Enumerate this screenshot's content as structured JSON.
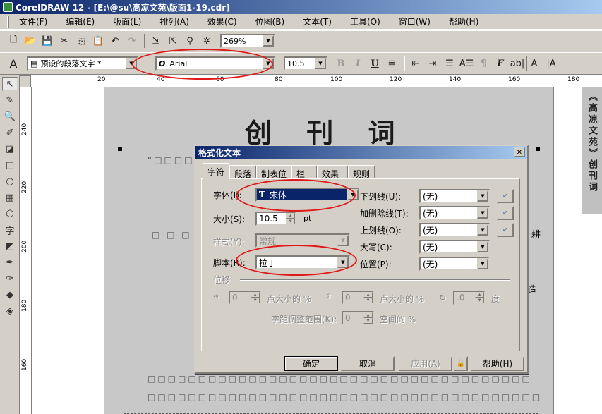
{
  "window": {
    "title": "CorelDRAW 12 - [E:\\@su\\高凉文苑\\版面1-19.cdr]"
  },
  "menu": [
    "文件(F)",
    "编辑(E)",
    "版面(L)",
    "排列(A)",
    "效果(C)",
    "位图(B)",
    "文本(T)",
    "工具(O)",
    "窗口(W)",
    "帮助(H)"
  ],
  "toolbar": {
    "zoom": "269%"
  },
  "propbar": {
    "style": "预设的段落文字 *",
    "font_icon": "O",
    "font": "Arial",
    "size": "10.5"
  },
  "rulers": {
    "h": [
      "20",
      "40",
      "60",
      "80",
      "100",
      "120",
      "140",
      "160",
      "180"
    ],
    "v": [
      "240",
      "220",
      "200",
      "180",
      "160"
    ]
  },
  "document": {
    "heading": "创 刊 词",
    "side_text": "《高凉文苑》创刊词",
    "first_line": "“□□□□□□□□□□□□□□□□□□□□□□□□□□□□□□□□□□□□",
    "bottom_line": "□□□□□□□□□□□□□□□□□□□□□□□□□□□□□□□□□□□□□□□□……",
    "right_chars": [
      "耕",
      "造"
    ],
    "left_gap_text": "□ □ □"
  },
  "dialog": {
    "title": "格式化文本",
    "tabs": [
      "字符",
      "段落",
      "制表位",
      "栏",
      "效果",
      "规则"
    ],
    "font_label": "字体(I):",
    "font_value": "宋体",
    "font_icon": "T",
    "size_label": "大小(S):",
    "size_value": "10.5",
    "size_unit": "pt",
    "style_label": "样式(Y):",
    "style_value": "常规",
    "script_label": "脚本(R):",
    "script_value": "拉丁",
    "underline_label": "下划线(U):",
    "strike_label": "加删除线(T):",
    "overline_label": "上划线(O):",
    "caps_label": "大写(C):",
    "position_label": "位置(P):",
    "none_value": "(无)",
    "shift_group": "位移",
    "shift_h_value": "0",
    "shift_v_value": "0",
    "shift_angle_value": ".0",
    "pct_pointsize": "点大小的 %",
    "degree": "度",
    "kerning_label": "字距调整范围(K):",
    "kerning_value": "0",
    "kerning_unit": "空间的 %",
    "buttons": {
      "ok": "确定",
      "cancel": "取消",
      "apply": "应用(A)",
      "help": "帮助(H)"
    }
  },
  "colors": {
    "titlebar": "#0a246a",
    "annotation": "#e01818",
    "selection": "#0a246a"
  }
}
